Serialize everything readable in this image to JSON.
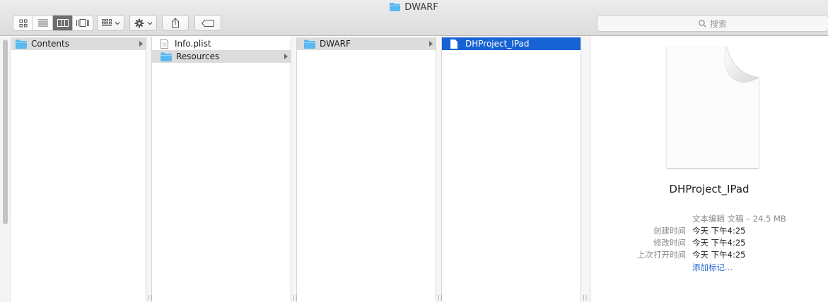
{
  "window": {
    "title": "DWARF"
  },
  "toolbar": {
    "view_modes": [
      "icon-view",
      "list-view",
      "column-view",
      "cover-flow-view"
    ],
    "active_view": "column-view",
    "search_placeholder": "搜索"
  },
  "columns": [
    {
      "items": [
        {
          "label": "Contents",
          "type": "folder",
          "state": "path",
          "has_children": true
        }
      ]
    },
    {
      "items": [
        {
          "label": "Info.plist",
          "type": "file",
          "state": "none",
          "has_children": false
        },
        {
          "label": "Resources",
          "type": "folder",
          "state": "path",
          "has_children": true
        }
      ]
    },
    {
      "items": [
        {
          "label": "DWARF",
          "type": "folder",
          "state": "path",
          "has_children": true
        }
      ]
    },
    {
      "items": [
        {
          "label": "DHProject_IPad",
          "type": "file",
          "state": "selected",
          "has_children": false
        }
      ]
    }
  ],
  "preview": {
    "name": "DHProject_IPad",
    "kind_size": "文本编辑 文稿 – 24.5 MB",
    "created_label": "创建时间",
    "created_value": "今天 下午4:25",
    "modified_label": "修改时间",
    "modified_value": "今天 下午4:25",
    "opened_label": "上次打开时间",
    "opened_value": "今天 下午4:25",
    "add_tags": "添加标记…"
  },
  "colors": {
    "selection_blue": "#1763d3",
    "folder_blue": "#5bb8f0",
    "link_blue": "#2a6ad4"
  }
}
